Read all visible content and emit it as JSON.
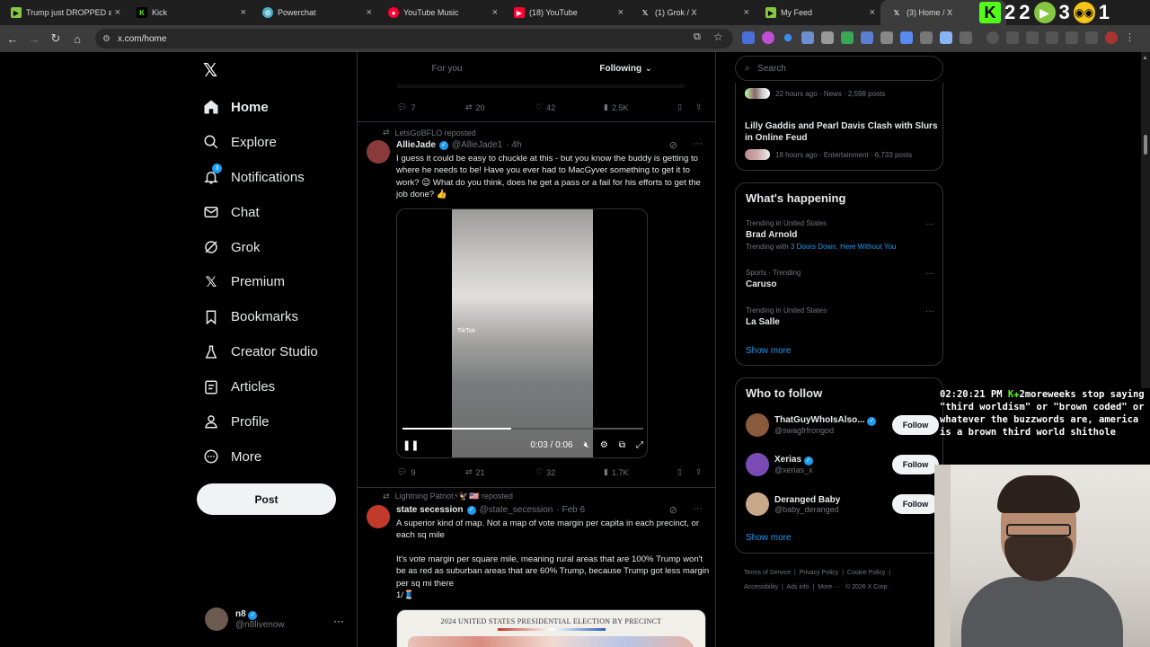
{
  "browser": {
    "tabs": [
      {
        "title": "Trump just DROPPED a",
        "icon": "rumble-icon",
        "color": "#85c742"
      },
      {
        "title": "Kick",
        "icon": "kick-icon",
        "color": "#53fc18"
      },
      {
        "title": "Powerchat",
        "icon": "powerchat-icon",
        "color": "#4fb0c6"
      },
      {
        "title": "YouTube Music",
        "icon": "youtube-music-icon",
        "color": "#ff0033"
      },
      {
        "title": "(18) YouTube",
        "icon": "youtube-icon",
        "color": "#ff0033"
      },
      {
        "title": "(1) Grok / X",
        "icon": "x-icon",
        "color": "#ffffff"
      },
      {
        "title": "My Feed",
        "icon": "rumble-icon",
        "color": "#85c742"
      },
      {
        "title": "(3) Home / X",
        "icon": "x-icon",
        "color": "#ffffff"
      }
    ],
    "overlay_counts": [
      "2",
      "2",
      "3",
      "1"
    ],
    "url": "x.com/home"
  },
  "sidebar": {
    "items": [
      {
        "label": "Home",
        "icon": "home-icon"
      },
      {
        "label": "Explore",
        "icon": "search-icon"
      },
      {
        "label": "Notifications",
        "icon": "bell-icon",
        "badge": "3"
      },
      {
        "label": "Chat",
        "icon": "mail-icon"
      },
      {
        "label": "Grok",
        "icon": "grok-icon"
      },
      {
        "label": "Premium",
        "icon": "x-icon"
      },
      {
        "label": "Bookmarks",
        "icon": "bookmark-icon"
      },
      {
        "label": "Creator Studio",
        "icon": "flask-icon"
      },
      {
        "label": "Articles",
        "icon": "article-icon"
      },
      {
        "label": "Profile",
        "icon": "person-icon"
      },
      {
        "label": "More",
        "icon": "more-circle-icon"
      }
    ],
    "post_label": "Post",
    "account": {
      "name": "n8",
      "handle": "@n8livenow"
    }
  },
  "timeline": {
    "tabs": [
      "For you",
      "Following"
    ],
    "top_actions": {
      "replies": "7",
      "reposts": "20",
      "likes": "42",
      "views": "2.5K"
    },
    "post1": {
      "repost_by": "LetsGoBFLO reposted",
      "name": "AllieJade",
      "handle": "@AllieJade1",
      "time": "· 4h",
      "text": "I guess it could be easy to chuckle at this - but you know the buddy is getting to where he needs to be! Have you ever had to MacGyver something to get it to work? 😉 What do you think, does he get a pass or a fail for his efforts to get the job done? 👍",
      "video_watermark": "TikTok",
      "video_time": "0:03 / 0:06",
      "progress": 0.45,
      "replies": "9",
      "reposts": "21",
      "likes": "32",
      "views": "1.7K"
    },
    "post2": {
      "repost_by": "Lightning Patriot⚡🦅🇺🇸 reposted",
      "name": "state secession",
      "handle": "@state_secession",
      "time": "· Feb 6",
      "text1": "A superior kind of map. Not a map of vote margin per capita in each precinct, or each sq mile",
      "text2": "It's vote margin per square mile, meaning rural areas that are 100% Trump won't be as red as suburban areas that are 60% Trump, because Trump got less margin per sq mi there",
      "text3": "1/🧵",
      "image_title": "2024 UNITED STATES PRESIDENTIAL ELECTION BY PRECINCT"
    }
  },
  "right": {
    "search_placeholder": "Search",
    "news1_meta": "22 hours ago · News · 2,598 posts",
    "news2_title": "Lilly Gaddis and Pearl Davis Clash with Slurs in Online Feud",
    "news2_meta": "18 hours ago · Entertainment · 6,733 posts",
    "happening_title": "What's happening",
    "trends": [
      {
        "context": "Trending in United States",
        "name": "Brad Arnold",
        "with_prefix": "Trending with ",
        "with": "3 Doors Down, Here Without You"
      },
      {
        "context": "Sports · Trending",
        "name": "Caruso"
      },
      {
        "context": "Trending in United States",
        "name": "La Salle"
      }
    ],
    "show_more": "Show more",
    "wtf_title": "Who to follow",
    "follow_label": "Follow",
    "wtf": [
      {
        "name": "ThatGuyWhoIsAlso...",
        "handle": "@swagfrfrongod",
        "color": "#8a5a3c"
      },
      {
        "name": "Xerias",
        "handle": "@xerias_x",
        "color": "#7b4bb5"
      },
      {
        "name": "Deranged Baby",
        "handle": "@baby_deranged",
        "color": "#c9a88a"
      }
    ],
    "footer": [
      "Terms of Service",
      "Privacy Policy",
      "Cookie Policy",
      "Accessibility",
      "Ads info",
      "More ···",
      "© 2026 X Corp."
    ]
  },
  "stream_chat": {
    "time": "02:20:21 PM",
    "user": "2moreweeks",
    "message": "stop saying \"third worldism\" or \"brown coded\" or whatever the buzzwords are, america is a brown third world shithole"
  }
}
